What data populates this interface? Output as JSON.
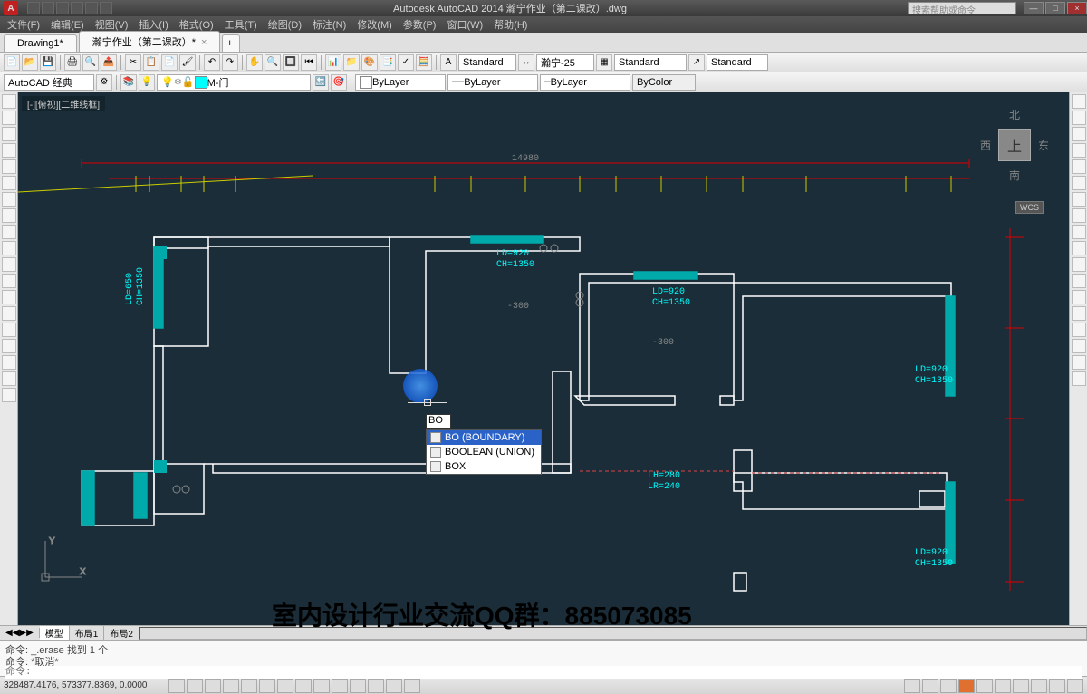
{
  "app": {
    "logo_letter": "A",
    "title": "Autodesk AutoCAD 2014    瀚宁作业（第二课改）.dwg",
    "search_placeholder": "搜索帮助或命令"
  },
  "window_controls": {
    "min": "—",
    "max": "□",
    "close": "×"
  },
  "menus": [
    "文件(F)",
    "编辑(E)",
    "视图(V)",
    "插入(I)",
    "格式(O)",
    "工具(T)",
    "绘图(D)",
    "标注(N)",
    "修改(M)",
    "参数(P)",
    "窗口(W)",
    "帮助(H)"
  ],
  "doc_tabs": [
    {
      "label": "Drawing1*",
      "closable": false
    },
    {
      "label": "瀚宁作业（第二课改）*",
      "closable": true
    }
  ],
  "toolbar1": {
    "text_style": "Standard",
    "dim_style": "瀚宁-25",
    "table_style": "Standard",
    "multi_style": "Standard"
  },
  "toolbar2": {
    "workspace": "AutoCAD 经典",
    "layer_current": "M-门",
    "layer_color": "#00ffff",
    "color_prop": "ByLayer",
    "ltype_prop": "ByLayer",
    "lweight_prop": "ByLayer",
    "plot_style": "ByColor"
  },
  "view": {
    "label": "[-][俯视][二维线框]",
    "cube": {
      "n": "北",
      "s": "南",
      "e": "东",
      "w": "西",
      "top": "上"
    },
    "wcs": "WCS"
  },
  "drawing_annotations": {
    "top_dim": "14980",
    "ld1": "LD=920",
    "ch1": "CH=1350",
    "ld2": "LD=920",
    "ch2": "CH=1350",
    "ld3": "LD=920",
    "ch3": "CH=1350",
    "ld4": "LD=920",
    "ch4": "CH=1350",
    "lh1": "LH=280",
    "lr1": "LR=240",
    "neg300a": "-300",
    "neg300b": "-300",
    "side": "LD=650",
    "ch_side": "CH=1350"
  },
  "floating_input": "BO",
  "autocomplete": [
    {
      "label": "BO (BOUNDARY)",
      "selected": true
    },
    {
      "label": "BOOLEAN (UNION)",
      "selected": false
    },
    {
      "label": "BOX",
      "selected": false
    }
  ],
  "model_tabs": {
    "arrows": "◀◀▶▶",
    "model": "模型",
    "layout1": "布局1",
    "layout2": "布局2"
  },
  "command": {
    "history1": "命令: _.erase 找到 1 个",
    "history2": "命令: *取消*",
    "prompt": "命令:"
  },
  "status": {
    "coords": "328487.4176, 573377.8369, 0.0000"
  },
  "watermark": "室内设计行业交流QQ群：885073085"
}
